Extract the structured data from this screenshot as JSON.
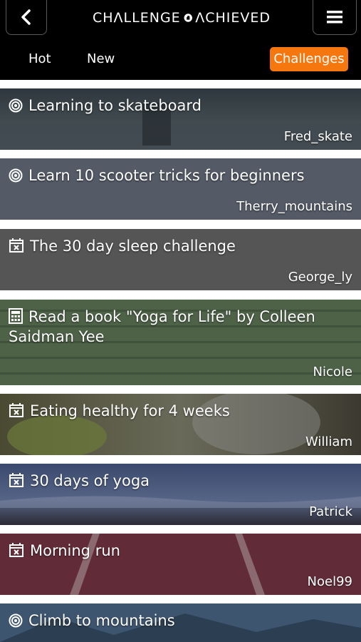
{
  "header": {
    "logo_left": "CHΛLLENGE",
    "logo_right": "ΛCHIEVED",
    "back_icon": "chevron-left-icon",
    "menu_icon": "hamburger-icon"
  },
  "tabs": {
    "hot": "Hot",
    "new": "New",
    "challenges": "Challenges",
    "active_color": "#f7770f"
  },
  "challenges": [
    {
      "title": "Learning to skateboard",
      "author": "Fred_skate",
      "icon": "target-icon"
    },
    {
      "title": "Learn 10 scooter tricks for beginners",
      "author": "Therry_mountains",
      "icon": "target-icon"
    },
    {
      "title": "The 30 day sleep challenge",
      "author": "George_ly",
      "icon": "calendar-x-icon"
    },
    {
      "title": "Read a book \"Yoga for Life\" by Colleen Saidman Yee",
      "author": "Nicole",
      "icon": "calculator-icon"
    },
    {
      "title": "Eating healthy for 4 weeks",
      "author": "William",
      "icon": "calendar-x-icon"
    },
    {
      "title": "30 days of yoga",
      "author": "Patrick",
      "icon": "calendar-x-icon"
    },
    {
      "title": "Morning run",
      "author": "Noel99",
      "icon": "calendar-x-icon"
    },
    {
      "title": "Climb to mountains",
      "author": "",
      "icon": "target-icon"
    }
  ]
}
